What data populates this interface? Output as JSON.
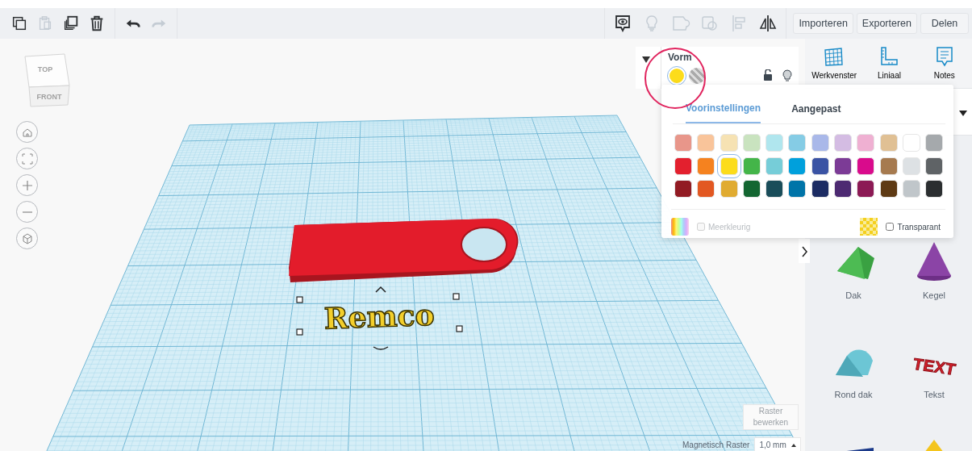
{
  "toolbar": {
    "edit_tools": [
      {
        "kind": "copy",
        "disabled": false
      },
      {
        "kind": "paste",
        "disabled": true
      },
      {
        "kind": "duplicate",
        "disabled": false
      },
      {
        "kind": "delete",
        "disabled": false
      },
      {
        "kind": "undo",
        "disabled": false
      },
      {
        "kind": "redo",
        "disabled": true
      }
    ],
    "view_tools": [
      {
        "kind": "notes",
        "disabled": false
      },
      {
        "kind": "bulb",
        "disabled": true
      },
      {
        "kind": "group",
        "disabled": true
      },
      {
        "kind": "ungroup",
        "disabled": true
      },
      {
        "kind": "align",
        "disabled": true
      },
      {
        "kind": "mirror",
        "disabled": false
      }
    ],
    "buttons": [
      "Importeren",
      "Exporteren",
      "Delen"
    ]
  },
  "view_cube": {
    "top": "TOP",
    "front": "FRONT"
  },
  "nav_buttons": [
    {
      "kind": "home"
    },
    {
      "kind": "fit"
    },
    {
      "kind": "zoom_in"
    },
    {
      "kind": "zoom_out"
    },
    {
      "kind": "perspective"
    }
  ],
  "workplane": {
    "objects": [
      {
        "kind": "keychain"
      },
      {
        "kind": "text",
        "text": "Remco",
        "selected": true
      }
    ]
  },
  "inspector": {
    "title": "Vorm",
    "solid_selected": true
  },
  "color_popup": {
    "tabs": [
      {
        "label": "Voorinstellingen",
        "selected": true
      },
      {
        "label": "Aangepast",
        "selected": false
      }
    ],
    "swatches": [
      {
        "color": "#e8968a",
        "selected": false
      },
      {
        "color": "#f9c49a",
        "selected": false
      },
      {
        "color": "#f6e2b3",
        "selected": false
      },
      {
        "color": "#c9e3bf",
        "selected": false
      },
      {
        "color": "#b0e6ee",
        "selected": false
      },
      {
        "color": "#85cce5",
        "selected": false
      },
      {
        "color": "#a9b8e9",
        "selected": false
      },
      {
        "color": "#d4bce3",
        "selected": false
      },
      {
        "color": "#efb0d2",
        "selected": false
      },
      {
        "color": "#e0c094",
        "selected": false
      },
      {
        "color": "#ffffff",
        "selected": false
      },
      {
        "color": "#a5a9ac",
        "selected": false
      },
      {
        "color": "#e3202e",
        "selected": false
      },
      {
        "color": "#f5821f",
        "selected": false
      },
      {
        "color": "#fcdc1b",
        "selected": true
      },
      {
        "color": "#44b549",
        "selected": false
      },
      {
        "color": "#76cdd8",
        "selected": false
      },
      {
        "color": "#00a0dc",
        "selected": false
      },
      {
        "color": "#3a53a4",
        "selected": false
      },
      {
        "color": "#7c3b96",
        "selected": false
      },
      {
        "color": "#d90b8c",
        "selected": false
      },
      {
        "color": "#a67a4f",
        "selected": false
      },
      {
        "color": "#dde1e4",
        "selected": false
      },
      {
        "color": "#5f6366",
        "selected": false
      },
      {
        "color": "#921b23",
        "selected": false
      },
      {
        "color": "#e25822",
        "selected": false
      },
      {
        "color": "#e0ab31",
        "selected": false
      },
      {
        "color": "#136631",
        "selected": false
      },
      {
        "color": "#1a4d5a",
        "selected": false
      },
      {
        "color": "#0074a8",
        "selected": false
      },
      {
        "color": "#1c2c63",
        "selected": false
      },
      {
        "color": "#4d2a72",
        "selected": false
      },
      {
        "color": "#8c1a55",
        "selected": false
      },
      {
        "color": "#5e3a14",
        "selected": false
      },
      {
        "color": "#c0c6ca",
        "selected": false
      },
      {
        "color": "#2b2e30",
        "selected": false
      }
    ],
    "multicolor": {
      "label": "Meerkleurig",
      "checked": false,
      "disabled": true
    },
    "transparent": {
      "label": "Transparant",
      "checked": false
    }
  },
  "right_panel": {
    "tools": [
      {
        "kind": "workplane",
        "label": "Werkvenster"
      },
      {
        "kind": "ruler",
        "label": "Liniaal"
      },
      {
        "kind": "notes",
        "label": "Notes"
      }
    ],
    "shapes": [
      {
        "kind": "roof",
        "label": "Dak"
      },
      {
        "kind": "cone",
        "label": "Kegel"
      },
      {
        "kind": "round_roof",
        "label": "Rond dak"
      },
      {
        "kind": "text",
        "label": "Tekst",
        "thumbnail_text": "TEXT"
      },
      {
        "kind": "prism"
      },
      {
        "kind": "pyramid"
      }
    ]
  },
  "grid_controls": {
    "edit_button": "Raster bewerken",
    "snap_label": "Magnetisch Raster",
    "snap_value": "1,0 mm"
  }
}
